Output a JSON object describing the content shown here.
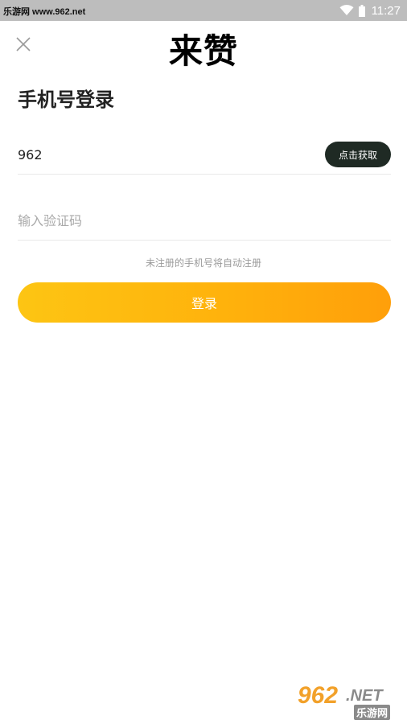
{
  "status_bar": {
    "site": "乐游网 www.962.net",
    "time": "11:27",
    "wifi_icon": "wifi-icon",
    "battery_icon": "battery-icon"
  },
  "header": {
    "close_icon": "close-icon",
    "app_title": "来赞",
    "page_title": "手机号登录"
  },
  "form": {
    "phone_value": "962",
    "get_code_label": "点击获取",
    "code_placeholder": "输入验证码",
    "hint": "未注册的手机号将自动注册",
    "login_label": "登录"
  },
  "watermark": {
    "number": "962",
    "suffix": ".NET",
    "subtitle": "乐游网"
  },
  "colors": {
    "accent_start": "#fdc513",
    "accent_end": "#ff9f0a",
    "dark_button": "#1f2a24",
    "status_bar": "#bdbdbd"
  }
}
